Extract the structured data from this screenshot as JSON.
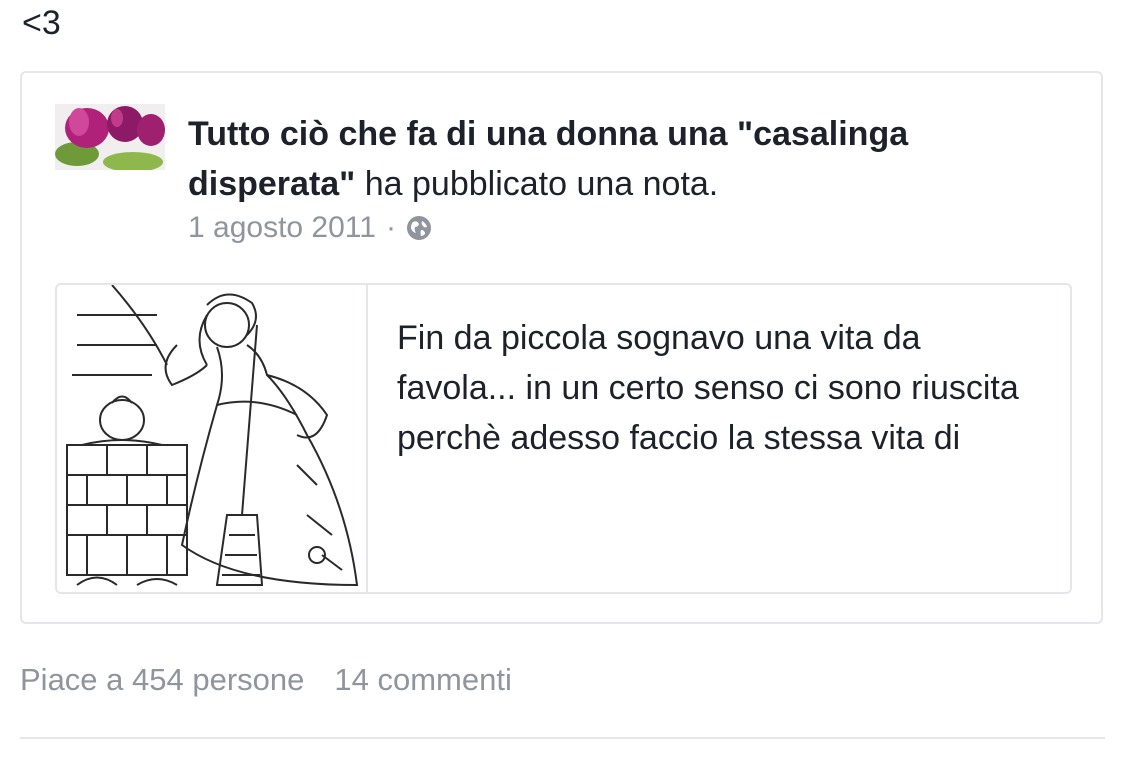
{
  "post": {
    "text": "<3"
  },
  "shared": {
    "page_name": "Tutto ciò che fa di una donna una \"casalinga disperata\"",
    "action": " ha pubblicato una nota.",
    "date": "1 agosto 2011",
    "separator": "·",
    "privacy_icon": "globe-icon",
    "note": {
      "excerpt": "Fin da piccola sognavo una vita da favola... in un certo senso ci sono riuscita perchè adesso faccio la stessa vita di"
    }
  },
  "footer": {
    "likes": "Piace a 454 persone",
    "comments": "14 commenti"
  }
}
